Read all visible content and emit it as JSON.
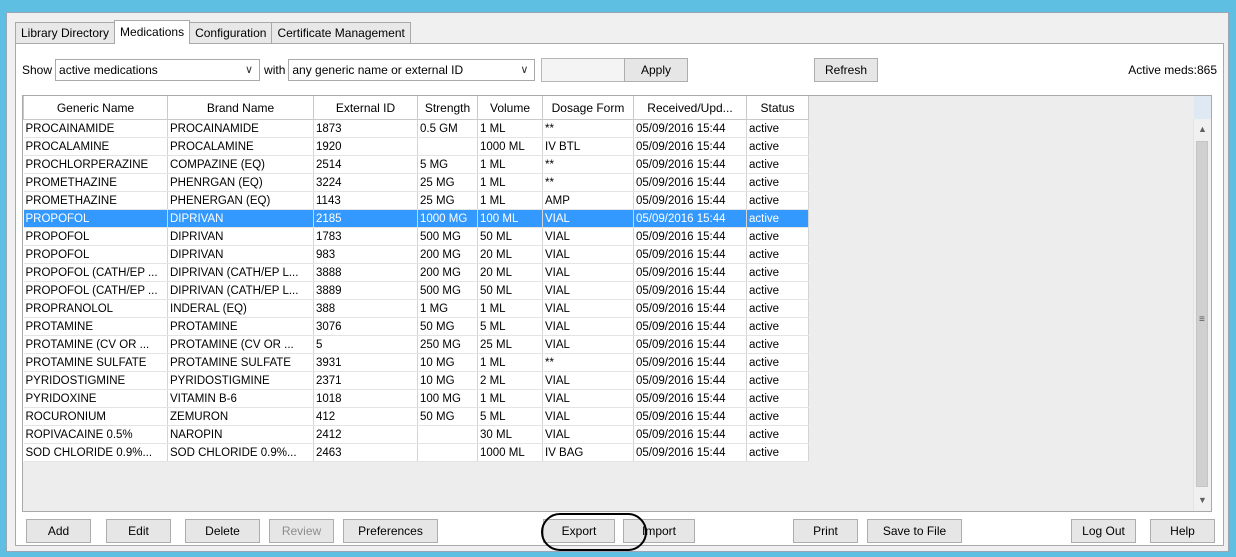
{
  "tabs": [
    "Library Directory",
    "Medications",
    "Configuration",
    "Certificate Management"
  ],
  "filter": {
    "show_label": "Show",
    "show_value": "active medications",
    "with_label": "with",
    "with_value": "any generic name or external ID",
    "search_value": "",
    "apply_label": "Apply",
    "refresh_label": "Refresh",
    "active_count": "Active meds:865"
  },
  "table": {
    "columns": [
      "Generic Name",
      "Brand Name",
      "External ID",
      "Strength",
      "Volume",
      "Dosage Form",
      "Received/Upd...",
      "Status"
    ],
    "rows": [
      [
        "PROCAINAMIDE",
        "PROCAINAMIDE",
        "1873",
        "0.5 GM",
        "1 ML",
        "**",
        "05/09/2016 15:44",
        "active"
      ],
      [
        "PROCALAMINE",
        "PROCALAMINE",
        "1920",
        "",
        "1000 ML",
        "IV BTL",
        "05/09/2016 15:44",
        "active"
      ],
      [
        "PROCHLORPERAZINE",
        "COMPAZINE (EQ)",
        "2514",
        "5 MG",
        "1 ML",
        "**",
        "05/09/2016 15:44",
        "active"
      ],
      [
        "PROMETHAZINE",
        "PHENRGAN (EQ)",
        "3224",
        "25 MG",
        "1 ML",
        "**",
        "05/09/2016 15:44",
        "active"
      ],
      [
        "PROMETHAZINE",
        "PHENERGAN (EQ)",
        "1143",
        "25 MG",
        "1 ML",
        "AMP",
        "05/09/2016 15:44",
        "active"
      ],
      [
        "PROPOFOL",
        "DIPRIVAN",
        "2185",
        "1000 MG",
        "100 ML",
        "VIAL",
        "05/09/2016 15:44",
        "active"
      ],
      [
        "PROPOFOL",
        "DIPRIVAN",
        "1783",
        "500 MG",
        "50 ML",
        "VIAL",
        "05/09/2016 15:44",
        "active"
      ],
      [
        "PROPOFOL",
        "DIPRIVAN",
        "983",
        "200 MG",
        "20 ML",
        "VIAL",
        "05/09/2016 15:44",
        "active"
      ],
      [
        "PROPOFOL (CATH/EP ...",
        "DIPRIVAN (CATH/EP L...",
        "3888",
        "200 MG",
        "20 ML",
        "VIAL",
        "05/09/2016 15:44",
        "active"
      ],
      [
        "PROPOFOL (CATH/EP ...",
        "DIPRIVAN (CATH/EP L...",
        "3889",
        "500 MG",
        "50 ML",
        "VIAL",
        "05/09/2016 15:44",
        "active"
      ],
      [
        "PROPRANOLOL",
        "INDERAL (EQ)",
        "388",
        "1 MG",
        "1 ML",
        "VIAL",
        "05/09/2016 15:44",
        "active"
      ],
      [
        "PROTAMINE",
        "PROTAMINE",
        "3076",
        "50 MG",
        "5 ML",
        "VIAL",
        "05/09/2016 15:44",
        "active"
      ],
      [
        "PROTAMINE (CV OR ...",
        "PROTAMINE (CV OR ...",
        "5",
        "250 MG",
        "25 ML",
        "VIAL",
        "05/09/2016 15:44",
        "active"
      ],
      [
        "PROTAMINE SULFATE",
        "PROTAMINE SULFATE",
        "3931",
        "10 MG",
        "1 ML",
        "**",
        "05/09/2016 15:44",
        "active"
      ],
      [
        "PYRIDOSTIGMINE",
        "PYRIDOSTIGMINE",
        "2371",
        "10 MG",
        "2 ML",
        "VIAL",
        "05/09/2016 15:44",
        "active"
      ],
      [
        "PYRIDOXINE",
        "VITAMIN B-6",
        "1018",
        "100 MG",
        "1 ML",
        "VIAL",
        "05/09/2016 15:44",
        "active"
      ],
      [
        "ROCURONIUM",
        "ZEMURON",
        "412",
        "50 MG",
        "5 ML",
        "VIAL",
        "05/09/2016 15:44",
        "active"
      ],
      [
        "ROPIVACAINE 0.5%",
        "NAROPIN",
        "2412",
        "",
        "30 ML",
        "VIAL",
        "05/09/2016 15:44",
        "active"
      ],
      [
        "SOD CHLORIDE 0.9%...",
        "SOD CHLORIDE 0.9%...",
        "2463",
        "",
        "1000 ML",
        "IV BAG",
        "05/09/2016 15:44",
        "active"
      ]
    ],
    "selected_index": 5
  },
  "buttons": {
    "add": "Add",
    "edit": "Edit",
    "delete": "Delete",
    "review": "Review",
    "preferences": "Preferences",
    "export": "Export",
    "import": "Import",
    "print": "Print",
    "save_to_file": "Save to File",
    "log_out": "Log Out",
    "help": "Help"
  },
  "colors": {
    "selection": "#3399ff",
    "desktop": "#5fbfe3"
  }
}
